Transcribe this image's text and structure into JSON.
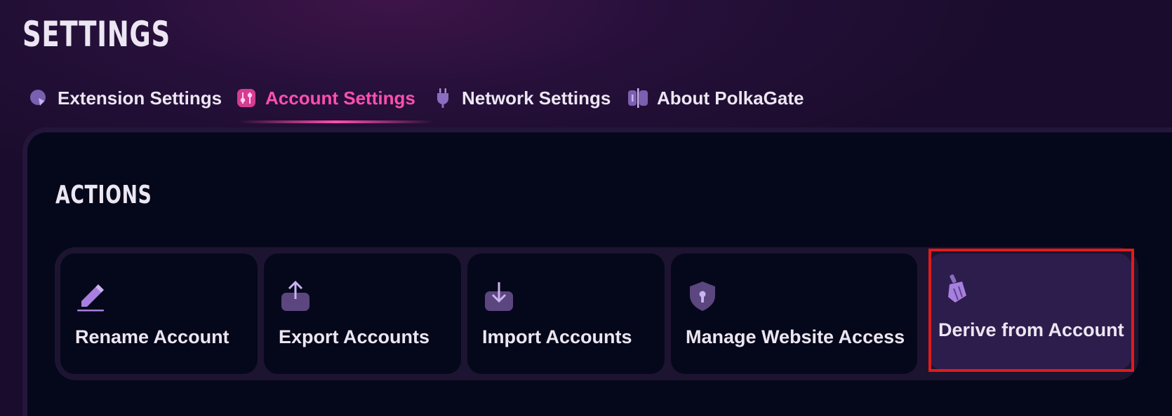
{
  "page": {
    "title": "SETTINGS"
  },
  "tabs": [
    {
      "label": "Extension Settings",
      "icon": "extension-settings-icon",
      "active": false
    },
    {
      "label": "Account Settings",
      "icon": "account-settings-sliders-icon",
      "active": true
    },
    {
      "label": "Network Settings",
      "icon": "plug-icon",
      "active": false
    },
    {
      "label": "About PolkaGate",
      "icon": "about-polkagate-icon",
      "active": false
    }
  ],
  "section": {
    "title": "ACTIONS"
  },
  "actions": [
    {
      "label": "Rename Account",
      "icon": "pencil-icon"
    },
    {
      "label": "Export Accounts",
      "icon": "upload-icon"
    },
    {
      "label": "Import Accounts",
      "icon": "download-icon"
    },
    {
      "label": "Manage Website Access",
      "icon": "shield-keyhole-icon"
    },
    {
      "label": "Derive from Account",
      "icon": "broom-icon",
      "selected": true
    }
  ],
  "colors": {
    "accent": "#ff4fb0",
    "icon_purple": "#a77fe0",
    "highlight": "#e01b1b",
    "panel": "#05081a"
  }
}
